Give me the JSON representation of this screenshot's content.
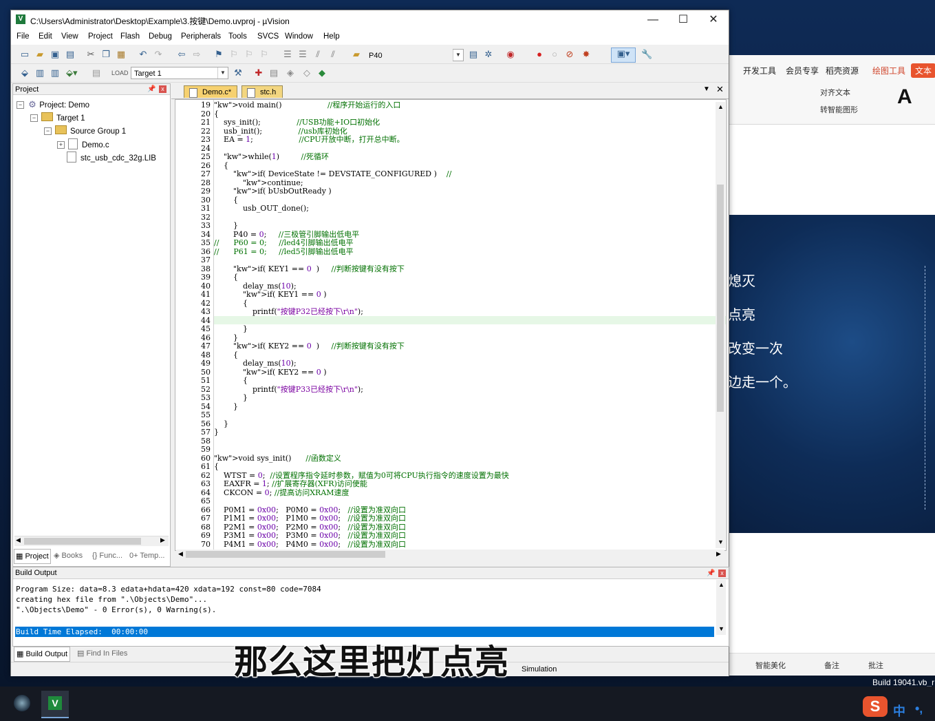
{
  "window": {
    "title": "C:\\Users\\Administrator\\Desktop\\Example\\3.按键\\Demo.uvproj - µVision",
    "controls": {
      "minimize": "—",
      "maximize": "☐",
      "close": "✕"
    }
  },
  "menu": [
    "File",
    "Edit",
    "View",
    "Project",
    "Flash",
    "Debug",
    "Peripherals",
    "Tools",
    "SVCS",
    "Window",
    "Help"
  ],
  "toolbar": {
    "find_combo": "P40",
    "target_combo": "Target 1"
  },
  "project_panel": {
    "title": "Project",
    "tree": {
      "project": "Project: Demo",
      "target": "Target 1",
      "group": "Source Group 1",
      "files": [
        "Demo.c",
        "stc_usb_cdc_32g.LIB"
      ]
    },
    "tabs": [
      "Project",
      "Books",
      "{} Func...",
      "0+ Temp..."
    ]
  },
  "editor": {
    "tabs": [
      "Demo.c*",
      "stc.h"
    ],
    "lines": [
      {
        "n": "19",
        "t": "void main()                   //程序开始运行的入口"
      },
      {
        "n": "20",
        "t": "{"
      },
      {
        "n": "21",
        "t": "    sys_init();               //USB功能+IO口初始化"
      },
      {
        "n": "22",
        "t": "    usb_init();               //usb库初始化"
      },
      {
        "n": "23",
        "t": "    EA = 1;                   //CPU开放中断，打开总中断。"
      },
      {
        "n": "24",
        "t": ""
      },
      {
        "n": "25",
        "t": "    while(1)         //死循环"
      },
      {
        "n": "26",
        "t": "    {"
      },
      {
        "n": "27",
        "t": "        if( DeviceState != DEVSTATE_CONFIGURED )    //"
      },
      {
        "n": "28",
        "t": "            continue;"
      },
      {
        "n": "29",
        "t": "        if( bUsbOutReady )"
      },
      {
        "n": "30",
        "t": "        {"
      },
      {
        "n": "31",
        "t": "            usb_OUT_done();"
      },
      {
        "n": "32",
        "t": ""
      },
      {
        "n": "33",
        "t": "        }"
      },
      {
        "n": "34",
        "t": "        P40 = 0;     //三极管引脚输出低电平"
      },
      {
        "n": "35",
        "t": "//      P60 = 0;     //led4引脚输出低电平"
      },
      {
        "n": "36",
        "t": "//      P61 = 0;     //led5引脚输出低电平"
      },
      {
        "n": "37",
        "t": ""
      },
      {
        "n": "38",
        "t": "        if( KEY1 == 0  )     //判断按键有没有按下"
      },
      {
        "n": "39",
        "t": "        {"
      },
      {
        "n": "40",
        "t": "            delay_ms(10);"
      },
      {
        "n": "41",
        "t": "            if( KEY1 == 0 )"
      },
      {
        "n": "42",
        "t": "            {"
      },
      {
        "n": "43",
        "t": "                printf(\"按键P32已经按下\\r\\n\");"
      },
      {
        "n": "44",
        "t": ""
      },
      {
        "n": "45",
        "t": "            }"
      },
      {
        "n": "46",
        "t": "        }"
      },
      {
        "n": "47",
        "t": "        if( KEY2 == 0  )     //判断按键有没有按下"
      },
      {
        "n": "48",
        "t": "        {"
      },
      {
        "n": "49",
        "t": "            delay_ms(10);"
      },
      {
        "n": "50",
        "t": "            if( KEY2 == 0 )"
      },
      {
        "n": "51",
        "t": "            {"
      },
      {
        "n": "52",
        "t": "                printf(\"按键P33已经按下\\r\\n\");"
      },
      {
        "n": "53",
        "t": "            }"
      },
      {
        "n": "54",
        "t": "        }"
      },
      {
        "n": "55",
        "t": ""
      },
      {
        "n": "56",
        "t": "    }"
      },
      {
        "n": "57",
        "t": "}"
      },
      {
        "n": "58",
        "t": ""
      },
      {
        "n": "59",
        "t": ""
      },
      {
        "n": "60",
        "t": "void sys_init()      //函数定义"
      },
      {
        "n": "61",
        "t": "{"
      },
      {
        "n": "62",
        "t": "    WTST = 0;  //设置程序指令延时参数，赋值为0可将CPU执行指令的速度设置为最快"
      },
      {
        "n": "63",
        "t": "    EAXFR = 1; //扩展寄存器(XFR)访问使能"
      },
      {
        "n": "64",
        "t": "    CKCON = 0; //提高访问XRAM速度"
      },
      {
        "n": "65",
        "t": ""
      },
      {
        "n": "66",
        "t": "    P0M1 = 0x00;   P0M0 = 0x00;   //设置为准双向口"
      },
      {
        "n": "67",
        "t": "    P1M1 = 0x00;   P1M0 = 0x00;   //设置为准双向口"
      },
      {
        "n": "68",
        "t": "    P2M1 = 0x00;   P2M0 = 0x00;   //设置为准双向口"
      },
      {
        "n": "69",
        "t": "    P3M1 = 0x00;   P3M0 = 0x00;   //设置为准双向口"
      },
      {
        "n": "70",
        "t": "    P4M1 = 0x00;   P4M0 = 0x00;   //设置为准双向口"
      }
    ]
  },
  "build_output": {
    "title": "Build Output",
    "lines": [
      "Program Size: data=8.3 edata+hdata=420 xdata=192 const=80 code=7084",
      "creating hex file from \".\\Objects\\Demo\"...",
      "\".\\Objects\\Demo\" - 0 Error(s), 0 Warning(s).",
      "Build Time Elapsed:  00:00:00"
    ],
    "tabs": [
      "Build Output",
      "Find In Files"
    ]
  },
  "status": {
    "mode": "Simulation"
  },
  "subtitle": "那么这里把灯点亮",
  "background_app": {
    "tabs": [
      "开发工具",
      "会员专享",
      "稻壳资源",
      "绘图工具",
      "文本"
    ],
    "tools": [
      "对齐文本",
      "转智能图形"
    ],
    "slide_lines": [
      "熄灭",
      "点亮",
      "改变一次",
      "边走一个。"
    ],
    "status_items": [
      "智能美化",
      "备注",
      "批注"
    ],
    "build": "Build 19041.vb_r"
  },
  "ime": {
    "label": "中"
  }
}
